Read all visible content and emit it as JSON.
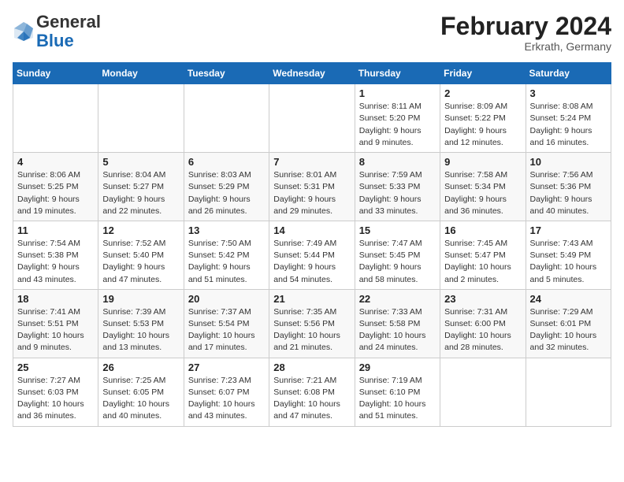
{
  "logo": {
    "general": "General",
    "blue": "Blue"
  },
  "header": {
    "month_year": "February 2024",
    "location": "Erkrath, Germany"
  },
  "weekdays": [
    "Sunday",
    "Monday",
    "Tuesday",
    "Wednesday",
    "Thursday",
    "Friday",
    "Saturday"
  ],
  "weeks": [
    [
      {
        "day": "",
        "info": ""
      },
      {
        "day": "",
        "info": ""
      },
      {
        "day": "",
        "info": ""
      },
      {
        "day": "",
        "info": ""
      },
      {
        "day": "1",
        "info": "Sunrise: 8:11 AM\nSunset: 5:20 PM\nDaylight: 9 hours\nand 9 minutes."
      },
      {
        "day": "2",
        "info": "Sunrise: 8:09 AM\nSunset: 5:22 PM\nDaylight: 9 hours\nand 12 minutes."
      },
      {
        "day": "3",
        "info": "Sunrise: 8:08 AM\nSunset: 5:24 PM\nDaylight: 9 hours\nand 16 minutes."
      }
    ],
    [
      {
        "day": "4",
        "info": "Sunrise: 8:06 AM\nSunset: 5:25 PM\nDaylight: 9 hours\nand 19 minutes."
      },
      {
        "day": "5",
        "info": "Sunrise: 8:04 AM\nSunset: 5:27 PM\nDaylight: 9 hours\nand 22 minutes."
      },
      {
        "day": "6",
        "info": "Sunrise: 8:03 AM\nSunset: 5:29 PM\nDaylight: 9 hours\nand 26 minutes."
      },
      {
        "day": "7",
        "info": "Sunrise: 8:01 AM\nSunset: 5:31 PM\nDaylight: 9 hours\nand 29 minutes."
      },
      {
        "day": "8",
        "info": "Sunrise: 7:59 AM\nSunset: 5:33 PM\nDaylight: 9 hours\nand 33 minutes."
      },
      {
        "day": "9",
        "info": "Sunrise: 7:58 AM\nSunset: 5:34 PM\nDaylight: 9 hours\nand 36 minutes."
      },
      {
        "day": "10",
        "info": "Sunrise: 7:56 AM\nSunset: 5:36 PM\nDaylight: 9 hours\nand 40 minutes."
      }
    ],
    [
      {
        "day": "11",
        "info": "Sunrise: 7:54 AM\nSunset: 5:38 PM\nDaylight: 9 hours\nand 43 minutes."
      },
      {
        "day": "12",
        "info": "Sunrise: 7:52 AM\nSunset: 5:40 PM\nDaylight: 9 hours\nand 47 minutes."
      },
      {
        "day": "13",
        "info": "Sunrise: 7:50 AM\nSunset: 5:42 PM\nDaylight: 9 hours\nand 51 minutes."
      },
      {
        "day": "14",
        "info": "Sunrise: 7:49 AM\nSunset: 5:44 PM\nDaylight: 9 hours\nand 54 minutes."
      },
      {
        "day": "15",
        "info": "Sunrise: 7:47 AM\nSunset: 5:45 PM\nDaylight: 9 hours\nand 58 minutes."
      },
      {
        "day": "16",
        "info": "Sunrise: 7:45 AM\nSunset: 5:47 PM\nDaylight: 10 hours\nand 2 minutes."
      },
      {
        "day": "17",
        "info": "Sunrise: 7:43 AM\nSunset: 5:49 PM\nDaylight: 10 hours\nand 5 minutes."
      }
    ],
    [
      {
        "day": "18",
        "info": "Sunrise: 7:41 AM\nSunset: 5:51 PM\nDaylight: 10 hours\nand 9 minutes."
      },
      {
        "day": "19",
        "info": "Sunrise: 7:39 AM\nSunset: 5:53 PM\nDaylight: 10 hours\nand 13 minutes."
      },
      {
        "day": "20",
        "info": "Sunrise: 7:37 AM\nSunset: 5:54 PM\nDaylight: 10 hours\nand 17 minutes."
      },
      {
        "day": "21",
        "info": "Sunrise: 7:35 AM\nSunset: 5:56 PM\nDaylight: 10 hours\nand 21 minutes."
      },
      {
        "day": "22",
        "info": "Sunrise: 7:33 AM\nSunset: 5:58 PM\nDaylight: 10 hours\nand 24 minutes."
      },
      {
        "day": "23",
        "info": "Sunrise: 7:31 AM\nSunset: 6:00 PM\nDaylight: 10 hours\nand 28 minutes."
      },
      {
        "day": "24",
        "info": "Sunrise: 7:29 AM\nSunset: 6:01 PM\nDaylight: 10 hours\nand 32 minutes."
      }
    ],
    [
      {
        "day": "25",
        "info": "Sunrise: 7:27 AM\nSunset: 6:03 PM\nDaylight: 10 hours\nand 36 minutes."
      },
      {
        "day": "26",
        "info": "Sunrise: 7:25 AM\nSunset: 6:05 PM\nDaylight: 10 hours\nand 40 minutes."
      },
      {
        "day": "27",
        "info": "Sunrise: 7:23 AM\nSunset: 6:07 PM\nDaylight: 10 hours\nand 43 minutes."
      },
      {
        "day": "28",
        "info": "Sunrise: 7:21 AM\nSunset: 6:08 PM\nDaylight: 10 hours\nand 47 minutes."
      },
      {
        "day": "29",
        "info": "Sunrise: 7:19 AM\nSunset: 6:10 PM\nDaylight: 10 hours\nand 51 minutes."
      },
      {
        "day": "",
        "info": ""
      },
      {
        "day": "",
        "info": ""
      }
    ]
  ]
}
